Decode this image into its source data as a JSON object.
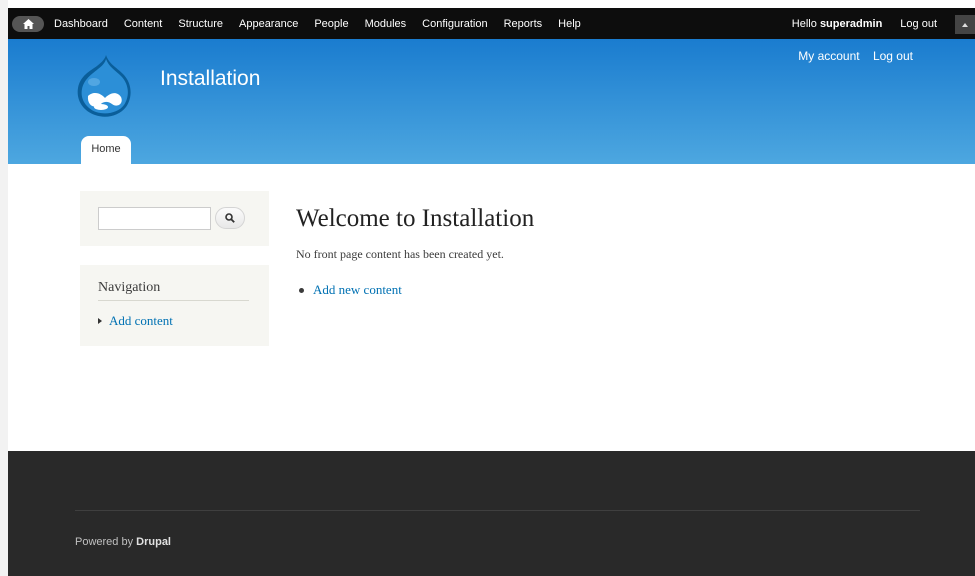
{
  "toolbar": {
    "menu": [
      "Dashboard",
      "Content",
      "Structure",
      "Appearance",
      "People",
      "Modules",
      "Configuration",
      "Reports",
      "Help"
    ],
    "hello_prefix": "Hello",
    "username": "superadmin",
    "logout": "Log out"
  },
  "header": {
    "site_name": "Installation",
    "secondary_menu": [
      "My account",
      "Log out"
    ],
    "tabs": [
      "Home"
    ]
  },
  "sidebar": {
    "search": {
      "value": "",
      "placeholder": ""
    },
    "navigation": {
      "title": "Navigation",
      "items": [
        "Add content"
      ]
    }
  },
  "main": {
    "title": "Welcome to Installation",
    "intro": "No front page content has been created yet.",
    "links": [
      "Add new content"
    ]
  },
  "footer": {
    "powered_by": "Powered by",
    "drupal": "Drupal"
  },
  "colors": {
    "header_top": "#1a7ccf",
    "header_bottom": "#4da7e0",
    "link": "#0071b3",
    "footer": "#292929"
  }
}
